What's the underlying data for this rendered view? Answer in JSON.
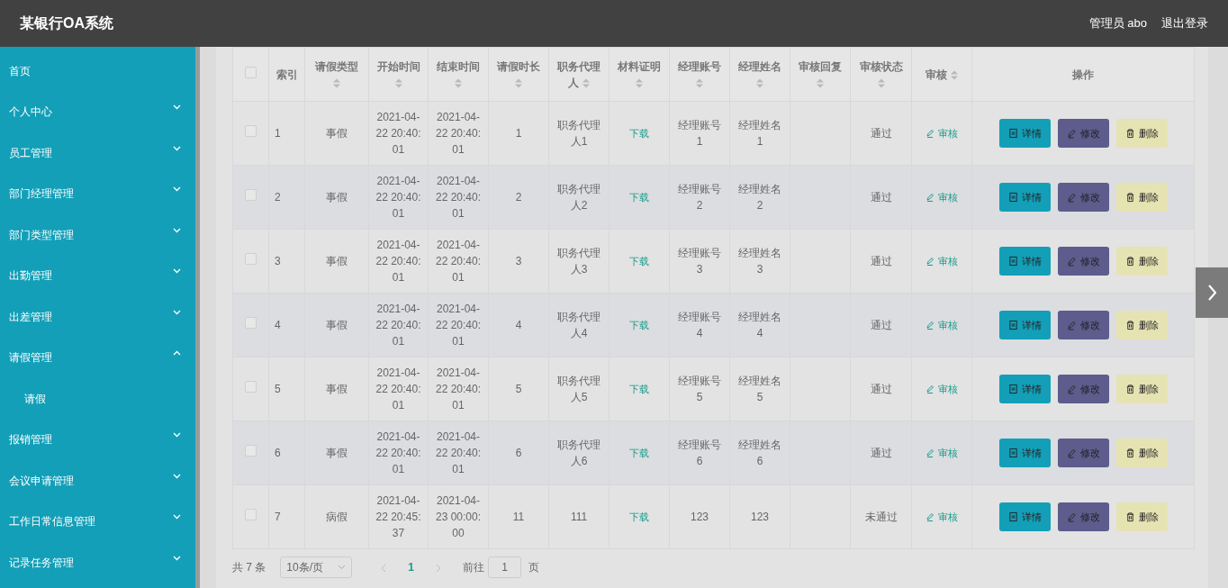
{
  "header": {
    "title": "某银行OA系统",
    "user": "管理员 abo",
    "logout": "退出登录"
  },
  "sidebar": {
    "items": [
      {
        "label": "首页",
        "kind": "link"
      },
      {
        "label": "个人中心",
        "kind": "menu",
        "expanded": false
      },
      {
        "label": "员工管理",
        "kind": "menu",
        "expanded": false
      },
      {
        "label": "部门经理管理",
        "kind": "menu",
        "expanded": false
      },
      {
        "label": "部门类型管理",
        "kind": "menu",
        "expanded": false
      },
      {
        "label": "出勤管理",
        "kind": "menu",
        "expanded": false
      },
      {
        "label": "出差管理",
        "kind": "menu",
        "expanded": false
      },
      {
        "label": "请假管理",
        "kind": "menu",
        "expanded": true,
        "children": [
          {
            "label": "请假"
          }
        ]
      },
      {
        "label": "报销管理",
        "kind": "menu",
        "expanded": false
      },
      {
        "label": "会议申请管理",
        "kind": "menu",
        "expanded": false
      },
      {
        "label": "工作日常信息管理",
        "kind": "menu",
        "expanded": false
      },
      {
        "label": "记录任务管理",
        "kind": "menu",
        "expanded": false
      }
    ]
  },
  "table": {
    "select_all": {
      "checked": false
    },
    "columns": [
      {
        "label": "索引",
        "sortable": false
      },
      {
        "label": "请假类型",
        "sortable": true
      },
      {
        "label": "开始时间",
        "sortable": true
      },
      {
        "label": "结束时间",
        "sortable": true
      },
      {
        "label": "请假时长",
        "sortable": true
      },
      {
        "label": "职务代理人",
        "sortable": true
      },
      {
        "label": "材料证明",
        "sortable": true
      },
      {
        "label": "经理账号",
        "sortable": true
      },
      {
        "label": "经理姓名",
        "sortable": true
      },
      {
        "label": "审核回复",
        "sortable": true
      },
      {
        "label": "审核状态",
        "sortable": true
      },
      {
        "label": "审核",
        "sortable": true
      },
      {
        "label": "操作",
        "sortable": false
      }
    ],
    "rows": [
      {
        "checked": false,
        "cells": [
          "1",
          "事假",
          "2021-04-22 20:40:01",
          "2021-04-22 20:40:01",
          "1",
          "职务代理人1",
          "下载",
          "经理账号1",
          "经理姓名1",
          "",
          "通过",
          "审核"
        ],
        "actions": [
          {
            "kind": "detail",
            "label": "详情"
          },
          {
            "kind": "edit",
            "label": "修改"
          },
          {
            "kind": "delete",
            "label": "删除"
          }
        ]
      },
      {
        "checked": false,
        "cells": [
          "2",
          "事假",
          "2021-04-22 20:40:01",
          "2021-04-22 20:40:01",
          "2",
          "职务代理人2",
          "下载",
          "经理账号2",
          "经理姓名2",
          "",
          "通过",
          "审核"
        ],
        "actions": [
          {
            "kind": "detail",
            "label": "详情"
          },
          {
            "kind": "edit",
            "label": "修改"
          },
          {
            "kind": "delete",
            "label": "删除"
          }
        ]
      },
      {
        "checked": false,
        "cells": [
          "3",
          "事假",
          "2021-04-22 20:40:01",
          "2021-04-22 20:40:01",
          "3",
          "职务代理人3",
          "下载",
          "经理账号3",
          "经理姓名3",
          "",
          "通过",
          "审核"
        ],
        "actions": [
          {
            "kind": "detail",
            "label": "详情"
          },
          {
            "kind": "edit",
            "label": "修改"
          },
          {
            "kind": "delete",
            "label": "删除"
          }
        ]
      },
      {
        "checked": false,
        "cells": [
          "4",
          "事假",
          "2021-04-22 20:40:01",
          "2021-04-22 20:40:01",
          "4",
          "职务代理人4",
          "下载",
          "经理账号4",
          "经理姓名4",
          "",
          "通过",
          "审核"
        ],
        "actions": [
          {
            "kind": "detail",
            "label": "详情"
          },
          {
            "kind": "edit",
            "label": "修改"
          },
          {
            "kind": "delete",
            "label": "删除"
          }
        ]
      },
      {
        "checked": false,
        "cells": [
          "5",
          "事假",
          "2021-04-22 20:40:01",
          "2021-04-22 20:40:01",
          "5",
          "职务代理人5",
          "下载",
          "经理账号5",
          "经理姓名5",
          "",
          "通过",
          "审核"
        ],
        "actions": [
          {
            "kind": "detail",
            "label": "详情"
          },
          {
            "kind": "edit",
            "label": "修改"
          },
          {
            "kind": "delete",
            "label": "删除"
          }
        ]
      },
      {
        "checked": false,
        "cells": [
          "6",
          "事假",
          "2021-04-22 20:40:01",
          "2021-04-22 20:40:01",
          "6",
          "职务代理人6",
          "下载",
          "经理账号6",
          "经理姓名6",
          "",
          "通过",
          "审核"
        ],
        "actions": [
          {
            "kind": "detail",
            "label": "详情"
          },
          {
            "kind": "edit",
            "label": "修改"
          },
          {
            "kind": "delete",
            "label": "删除"
          }
        ]
      },
      {
        "checked": false,
        "cells": [
          "7",
          "病假",
          "2021-04-22 20:45:37",
          "2021-04-23 00:00:00",
          "11",
          "111",
          "下载",
          "123",
          "123",
          "",
          "未通过",
          "审核"
        ],
        "actions": [
          {
            "kind": "detail",
            "label": "详情"
          },
          {
            "kind": "edit",
            "label": "修改"
          },
          {
            "kind": "delete",
            "label": "删除"
          }
        ]
      }
    ]
  },
  "pagination": {
    "total": "共 7 条",
    "page_size": "10条/页",
    "pages": [
      {
        "label": "1",
        "selected": true
      }
    ],
    "goto": "前往",
    "goto_value": "1",
    "goto_unit": "页"
  }
}
